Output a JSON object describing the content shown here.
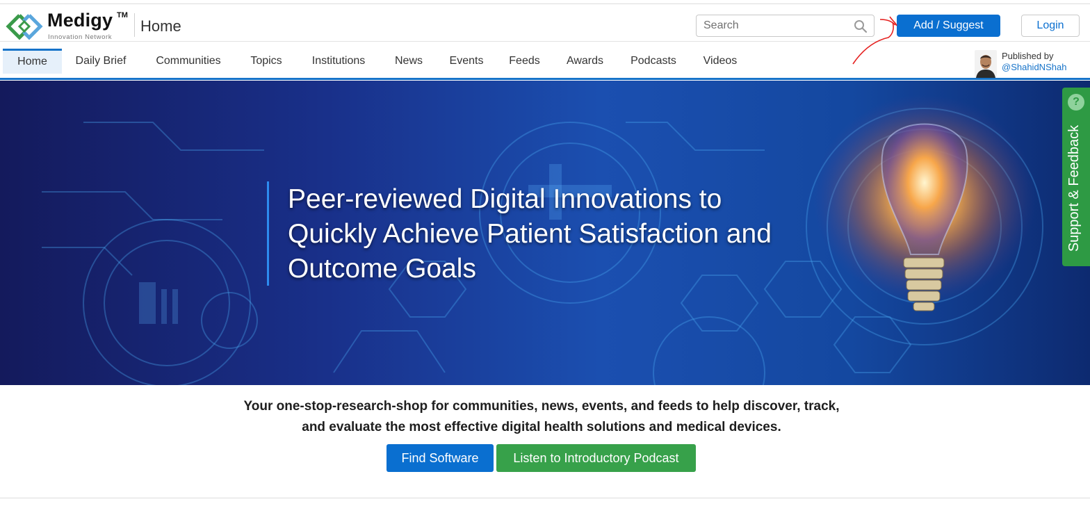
{
  "brand": {
    "name": "Medigy",
    "trademark": "TM",
    "subtitle": "Innovation Network",
    "colors": {
      "primary": "#0a6fd0",
      "green": "#37a14a",
      "logo_green": "#3a9a4a",
      "logo_blue": "#5aa6dc"
    }
  },
  "header": {
    "page_title": "Home",
    "search": {
      "placeholder": "Search",
      "value": "",
      "icon": "search-icon"
    },
    "add_suggest_label": "Add / Suggest",
    "login_label": "Login"
  },
  "nav": {
    "items": [
      {
        "label": "Home",
        "active": true
      },
      {
        "label": "Daily Brief",
        "active": false
      },
      {
        "label": "Communities",
        "active": false
      },
      {
        "label": "Topics",
        "active": false
      },
      {
        "label": "Institutions",
        "active": false
      },
      {
        "label": "News",
        "active": false
      },
      {
        "label": "Events",
        "active": false
      },
      {
        "label": "Feeds",
        "active": false
      },
      {
        "label": "Awards",
        "active": false
      },
      {
        "label": "Podcasts",
        "active": false
      },
      {
        "label": "Videos",
        "active": false
      }
    ]
  },
  "publisher": {
    "label": "Published by",
    "handle": "@ShahidNShah"
  },
  "hero": {
    "title_lines": [
      "Peer-reviewed Digital Innovations to",
      "Quickly Achieve Patient Satisfaction and",
      "Outcome Goals"
    ]
  },
  "support": {
    "label": "Support & Feedback",
    "icon_glyph": "?"
  },
  "tagline_lines": [
    "Your one-stop-research-shop for communities, news, events, and feeds to help discover, track,",
    "and evaluate the most effective digital health solutions and medical devices."
  ],
  "cta": {
    "find_software": "Find Software",
    "podcast": "Listen to Introductory Podcast"
  }
}
